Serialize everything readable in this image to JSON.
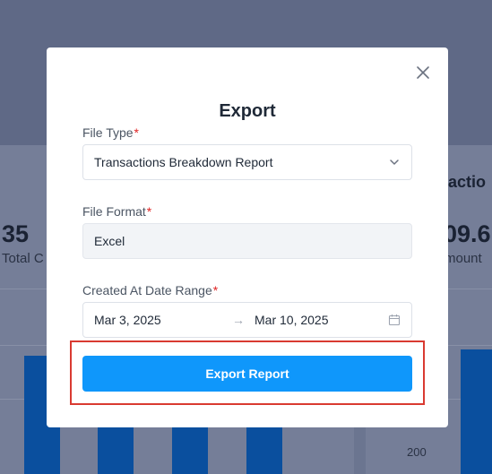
{
  "background": {
    "stat_left_value": "35",
    "stat_left_label": "Total C",
    "stat_right_title": "actio",
    "stat_right_value": "09.6",
    "stat_right_label": "mount",
    "axis_label": "200"
  },
  "modal": {
    "title": "Export",
    "file_type": {
      "label": "File Type",
      "required_mark": "*",
      "value": "Transactions Breakdown Report"
    },
    "file_format": {
      "label": "File Format",
      "required_mark": "*",
      "value": "Excel"
    },
    "date_range": {
      "label": "Created At Date Range",
      "required_mark": "*",
      "start": "Mar 3, 2025",
      "separator": "→",
      "end": "Mar 10, 2025"
    },
    "export_button_label": "Export Report"
  },
  "colors": {
    "primary": "#0f97fb",
    "highlight": "#d93a31",
    "required": "#e02424"
  },
  "icons": {
    "close": "close-icon",
    "dropdown": "chevron-down-icon",
    "calendar": "calendar-icon"
  }
}
